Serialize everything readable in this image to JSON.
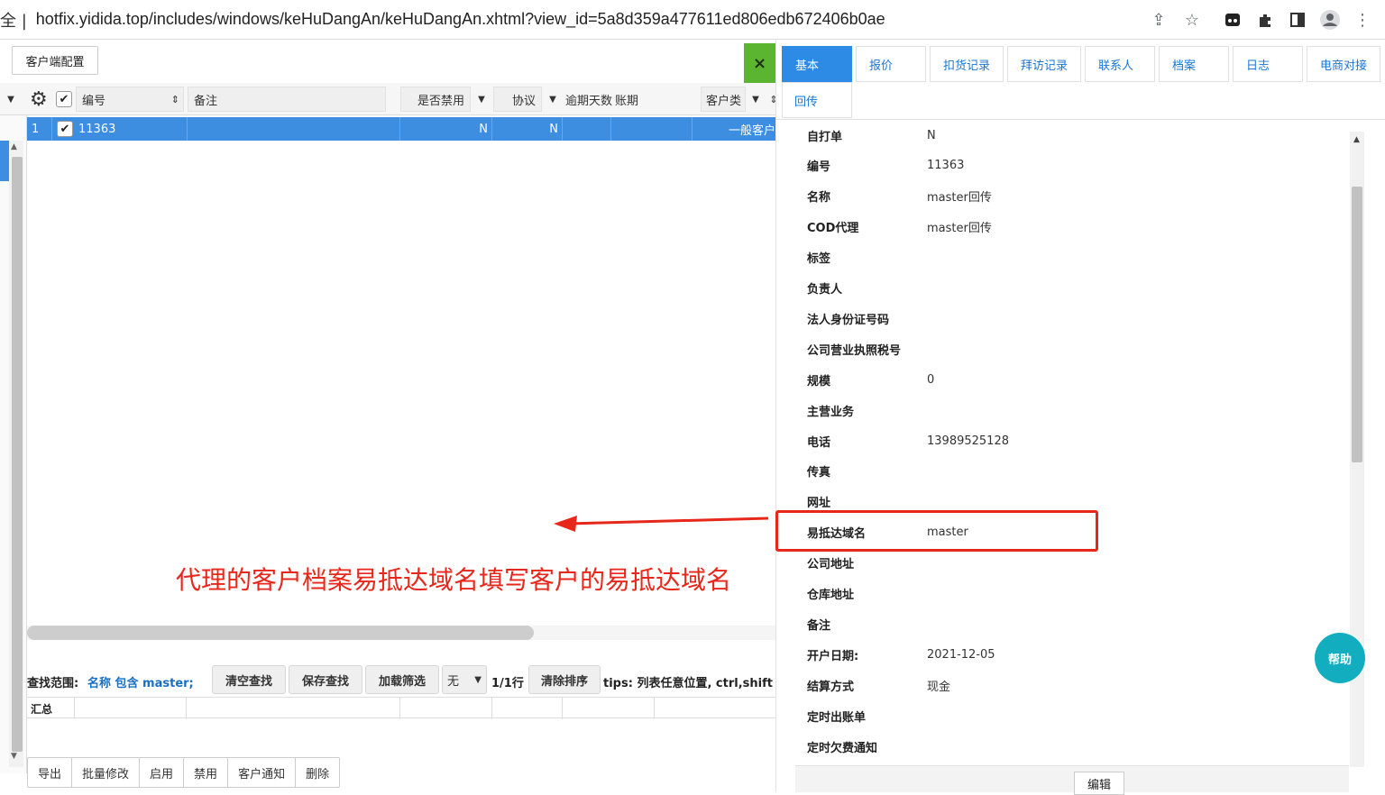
{
  "browser": {
    "left_fragment": "全 |",
    "url": "hotfix.yidida.top/includes/windows/keHuDangAn/keHuDangAn.xhtml?view_id=5a8d359a477611ed806edb672406b0ae"
  },
  "left": {
    "config_button": "客户端配置",
    "close_label": "×",
    "columns": {
      "code": "编号",
      "remark": "备注",
      "disabled": "是否禁用",
      "agreement": "协议",
      "overdue_days": "逾期天数",
      "account_period": "账期",
      "customer_type": "客户类"
    },
    "row": {
      "index": "1",
      "code": "11363",
      "disabled": "N",
      "agreement": "N",
      "customer_type": "一般客户"
    },
    "search": {
      "scope_label": "查找范围:",
      "scope_value": "名称 包含 master;",
      "clear": "清空查找",
      "save": "保存查找",
      "load": "加载筛选",
      "none_select": "无",
      "row_count": "1/1行",
      "clear_sort": "清除排序",
      "tips": "tips: 列表任意位置, ctrl,shift"
    },
    "summary_label": "汇总",
    "bottom_buttons": [
      "导出",
      "批量修改",
      "启用",
      "禁用",
      "客户通知",
      "删除"
    ]
  },
  "annotation": "代理的客户档案易抵达域名填写客户的易抵达域名",
  "right": {
    "tabs": [
      "基本",
      "报价",
      "扣货记录",
      "拜访记录",
      "联系人",
      "档案",
      "日志",
      "电商对接",
      "回传"
    ],
    "fields": [
      {
        "label": "自打单",
        "value": "N"
      },
      {
        "label": "编号",
        "value": "11363"
      },
      {
        "label": "名称",
        "value": "master回传"
      },
      {
        "label": "COD代理",
        "value": "master回传"
      },
      {
        "label": "标签",
        "value": ""
      },
      {
        "label": "负责人",
        "value": ""
      },
      {
        "label": "法人身份证号码",
        "value": ""
      },
      {
        "label": "公司营业执照税号",
        "value": ""
      },
      {
        "label": "规模",
        "value": "0"
      },
      {
        "label": "主营业务",
        "value": ""
      },
      {
        "label": "电话",
        "value": "13989525128"
      },
      {
        "label": "传真",
        "value": ""
      },
      {
        "label": "网址",
        "value": ""
      },
      {
        "label": "易抵达域名",
        "value": "master"
      },
      {
        "label": "公司地址",
        "value": ""
      },
      {
        "label": "仓库地址",
        "value": ""
      },
      {
        "label": "备注",
        "value": ""
      },
      {
        "label": "开户日期:",
        "value": "2021-12-05"
      },
      {
        "label": "结算方式",
        "value": "现金"
      },
      {
        "label": "定时出账单",
        "value": ""
      },
      {
        "label": "定时欠费通知",
        "value": ""
      }
    ],
    "help": "帮助",
    "edit": "编辑"
  },
  "colors": {
    "accent": "#2d8be6",
    "annotation": "#e8271b",
    "help": "#12aec0",
    "close": "#5cb531"
  }
}
